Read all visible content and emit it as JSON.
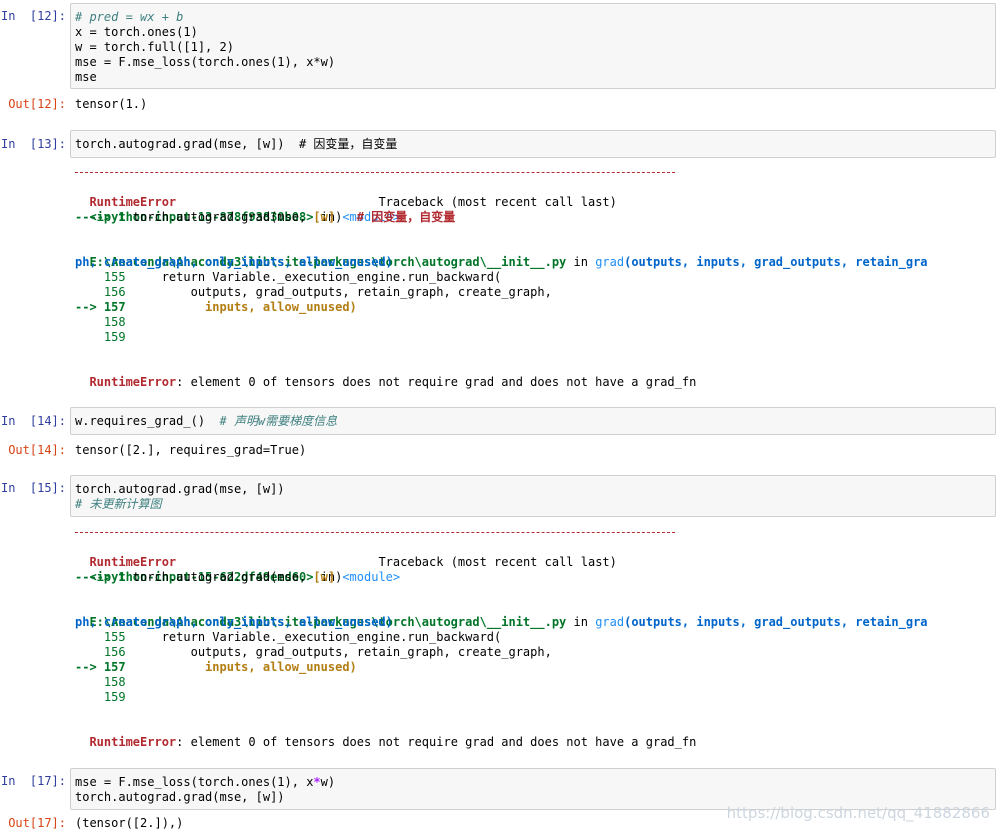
{
  "cells": [
    {
      "prompt_in": "In  [12]:",
      "prompt_out": "Out[12]:",
      "input": [
        "# pred = wx + b",
        "x = torch.ones(1)",
        "w = torch.full([1], 2)",
        "mse = F.mse_loss(torch.ones(1), x*w)",
        "mse"
      ],
      "output": "tensor(1.)"
    },
    {
      "prompt_in": "In  [13]:",
      "input": [
        "torch.autograd.grad(mse, [w])  # 因变量，自变量"
      ]
    },
    {
      "prompt_in": "In  [14]:",
      "prompt_out": "Out[14]:",
      "input": [
        "w.requires_grad_()  # 声明w需要梯度信息"
      ],
      "output": "tensor([2.], requires_grad=True)"
    },
    {
      "prompt_in": "In  [15]:",
      "input": [
        "torch.autograd.grad(mse, [w])",
        "# 未更新计算图"
      ]
    },
    {
      "prompt_in": "In  [17]:",
      "prompt_out": "Out[17]:",
      "input": [
        "mse = F.mse_loss(torch.ones(1), x*w)",
        "torch.autograd.grad(mse, [w])"
      ],
      "output": "(tensor([2.]),)"
    }
  ],
  "traceback1": {
    "err_name": "RuntimeError",
    "tb_title": "Traceback (most recent call last)",
    "ipy_input": "<ipython-input-13-878f93830b08>",
    "in_word": " in ",
    "module": "<module>",
    "arrow_line": "----> 1 torch.autograd.grad(mse, [w])  # 因变量，自变量",
    "file_path": "E:\\Anaconda\\Anaconda3\\lib\\site-packages\\torch\\autograd\\__init__.py",
    "func": "grad",
    "sig1": "(outputs, inputs, grad_outputs, retain_gra",
    "sig2": "ph, create_graph, only_inputs, allow_unused)",
    "l155": "    155     return Variable._execution_engine.run_backward(",
    "l156": "    156         outputs, grad_outputs, retain_graph, create_graph,",
    "l157": "--> 157           inputs, allow_unused)",
    "l158": "    158",
    "l159": "    159",
    "final_msg": ": element 0 of tensors does not require grad and does not have a grad_fn"
  },
  "traceback2": {
    "ipy_input": "<ipython-input-15-622df49eed60>",
    "arrow_line": "----> 1 torch.autograd.grad(mse, [w])"
  },
  "watermark": "https://blog.csdn.net/qq_41882866"
}
